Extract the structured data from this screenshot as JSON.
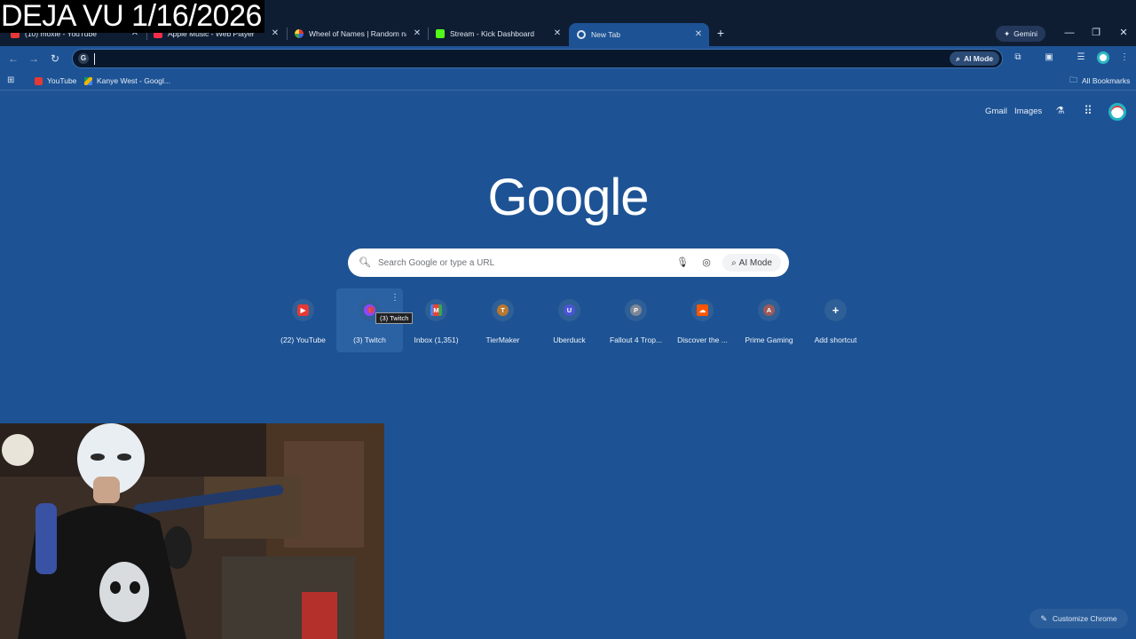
{
  "overlay": {
    "caption": "DEJA VU 1/16/2026"
  },
  "tabs": [
    {
      "title": "(10) moxie - YouTube",
      "favicon": "youtube-icon",
      "color": "#e53935"
    },
    {
      "title": "Apple Music - Web Player",
      "favicon": "apple-music-icon",
      "color": "#fa2d48"
    },
    {
      "title": "Wheel of Names | Random nam",
      "favicon": "wheel-of-names-icon",
      "color": "#3e64e0"
    },
    {
      "title": "Stream - Kick Dashboard",
      "favicon": "kick-icon",
      "color": "#53fc18"
    },
    {
      "title": "New Tab",
      "favicon": "chrome-icon",
      "color": "#dfe6f0",
      "active": true
    }
  ],
  "window": {
    "gemini_label": "Gemini"
  },
  "toolbar": {
    "omnibox_value": "",
    "ai_mode_label": "AI Mode"
  },
  "bookmarks": {
    "items": [
      {
        "label": "YouTube",
        "favicon": "youtube-icon",
        "color": "#e53935"
      },
      {
        "label": "Kanye West - Googl...",
        "favicon": "google-drive-icon",
        "color": "#f4b400"
      }
    ],
    "all_bookmarks_label": "All Bookmarks"
  },
  "ntp": {
    "gmail_label": "Gmail",
    "images_label": "Images",
    "logo_text": "Google",
    "search_placeholder": "Search Google or type a URL",
    "ai_mode_label": "AI Mode",
    "customize_label": "Customize Chrome",
    "tooltip": "(3) Twitch",
    "shortcuts": [
      {
        "label": "(22) YouTube",
        "icon": "youtube-icon",
        "color": "#e53935",
        "glyph": "▶"
      },
      {
        "label": "(3) Twitch",
        "icon": "twitch-icon",
        "color": "#9146ff",
        "glyph": "t"
      },
      {
        "label": "Inbox (1,351)",
        "icon": "gmail-icon",
        "color": "#2f5f97",
        "glyph": "M"
      },
      {
        "label": "TierMaker",
        "icon": "letter-t-icon",
        "color": "#b9772f",
        "glyph": "T"
      },
      {
        "label": "Uberduck",
        "icon": "letter-u-icon",
        "color": "#4a55d6",
        "glyph": "U"
      },
      {
        "label": "Fallout 4 Trop...",
        "icon": "letter-p-icon",
        "color": "#7b8794",
        "glyph": "P"
      },
      {
        "label": "Discover the ...",
        "icon": "soundcloud-icon",
        "color": "#ff5500",
        "glyph": "☁"
      },
      {
        "label": "Prime Gaming",
        "icon": "letter-a-icon",
        "color": "#9d5a5a",
        "glyph": "A"
      },
      {
        "label": "Add shortcut",
        "icon": "add-icon",
        "color": "#2f5f97",
        "glyph": "+"
      }
    ]
  }
}
